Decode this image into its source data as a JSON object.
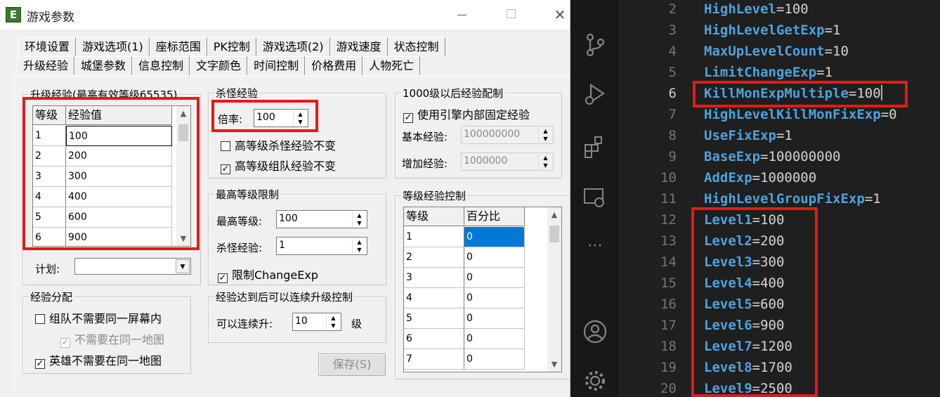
{
  "dialog": {
    "title": "游戏参数",
    "app_icon_letter": "E",
    "tabs_row1": [
      "环境设置",
      "游戏选项(1)",
      "座标范围",
      "PK控制",
      "游戏选项(2)",
      "游戏速度",
      "状态控制"
    ],
    "tabs_row2": [
      "升级经验",
      "城堡参数",
      "信息控制",
      "文字颜色",
      "时间控制",
      "价格费用",
      "人物死亡"
    ],
    "active_tab": "升级经验"
  },
  "upgrade_exp": {
    "group_label": "升级经验(最高有效等级65535)",
    "headers": [
      "等级",
      "经验值"
    ],
    "rows": [
      {
        "level": "1",
        "exp": "100"
      },
      {
        "level": "2",
        "exp": "200"
      },
      {
        "level": "3",
        "exp": "300"
      },
      {
        "level": "4",
        "exp": "400"
      },
      {
        "level": "5",
        "exp": "600"
      },
      {
        "level": "6",
        "exp": "900"
      }
    ],
    "plan_label": "计划:",
    "plan_value": ""
  },
  "exp_distribution": {
    "group_label": "经验分配",
    "opt1": {
      "label": "组队不需要同一屏幕内",
      "checked": false
    },
    "opt2": {
      "label": "不需要在同一地图",
      "checked": true,
      "disabled": true
    },
    "opt3": {
      "label": "英雄不需要在同一地图",
      "checked": true
    }
  },
  "kill_exp": {
    "group_label": "杀怪经验",
    "rate_label": "倍率:",
    "rate_value": "100",
    "opt1": {
      "label": "高等级杀怪经验不变",
      "checked": false
    },
    "opt2": {
      "label": "高等级组队经验不变",
      "checked": true
    }
  },
  "max_level": {
    "group_label": "最高等级限制",
    "max_label": "最高等级:",
    "max_value": "100",
    "kill_label": "杀怪经验:",
    "kill_value": "1",
    "limit": {
      "label": "限制ChangeExp",
      "checked": true
    }
  },
  "continuous": {
    "group_label": "经验达到后可以连续升级控制",
    "label": "可以连续升:",
    "value": "10",
    "unit": "级"
  },
  "save_button": "保存(S)",
  "after1000": {
    "group_label": "1000级以后经验配制",
    "use_fixed": {
      "label": "使用引擎内部固定经验",
      "checked": true
    },
    "base_label": "基本经验:",
    "base_value": "100000000",
    "add_label": "增加经验:",
    "add_value": "1000000"
  },
  "level_exp_control": {
    "group_label": "等级经验控制",
    "headers": [
      "等级",
      "百分比"
    ],
    "rows": [
      {
        "level": "1",
        "percent": "0"
      },
      {
        "level": "2",
        "percent": "0"
      },
      {
        "level": "3",
        "percent": "0"
      },
      {
        "level": "4",
        "percent": "0"
      },
      {
        "level": "5",
        "percent": "0"
      },
      {
        "level": "6",
        "percent": "0"
      },
      {
        "level": "7",
        "percent": "0"
      }
    ]
  },
  "editor": {
    "current_line": "6",
    "lines": [
      {
        "num": "2",
        "key": "HighLevel",
        "value": "100"
      },
      {
        "num": "3",
        "key": "HighLevelGetExp",
        "value": "1"
      },
      {
        "num": "4",
        "key": "MaxUpLevelCount",
        "value": "10"
      },
      {
        "num": "5",
        "key": "LimitChangeExp",
        "value": "1"
      },
      {
        "num": "6",
        "key": "KillMonExpMultiple",
        "value": "100"
      },
      {
        "num": "7",
        "key": "HighLevelKillMonFixExp",
        "value": "0"
      },
      {
        "num": "8",
        "key": "UseFixExp",
        "value": "1"
      },
      {
        "num": "9",
        "key": "BaseExp",
        "value": "100000000"
      },
      {
        "num": "10",
        "key": "AddExp",
        "value": "1000000"
      },
      {
        "num": "11",
        "key": "HighLevelGroupFixExp",
        "value": "1"
      },
      {
        "num": "12",
        "key": "Level1",
        "value": "100"
      },
      {
        "num": "13",
        "key": "Level2",
        "value": "200"
      },
      {
        "num": "14",
        "key": "Level3",
        "value": "300"
      },
      {
        "num": "15",
        "key": "Level4",
        "value": "400"
      },
      {
        "num": "16",
        "key": "Level5",
        "value": "600"
      },
      {
        "num": "17",
        "key": "Level6",
        "value": "900"
      },
      {
        "num": "18",
        "key": "Level7",
        "value": "1200"
      },
      {
        "num": "19",
        "key": "Level8",
        "value": "1700"
      },
      {
        "num": "20",
        "key": "Level9",
        "value": "2500"
      }
    ]
  },
  "activity_icons": [
    "explorer-icon",
    "source-control-icon",
    "run-debug-icon",
    "extensions-icon",
    "remote-explorer-icon",
    "more-icon",
    "account-icon",
    "settings-gear-icon"
  ],
  "colors": {
    "highlight_red": "#e81818",
    "selection_blue": "#0078d7",
    "code_key": "#4fa2dd"
  }
}
